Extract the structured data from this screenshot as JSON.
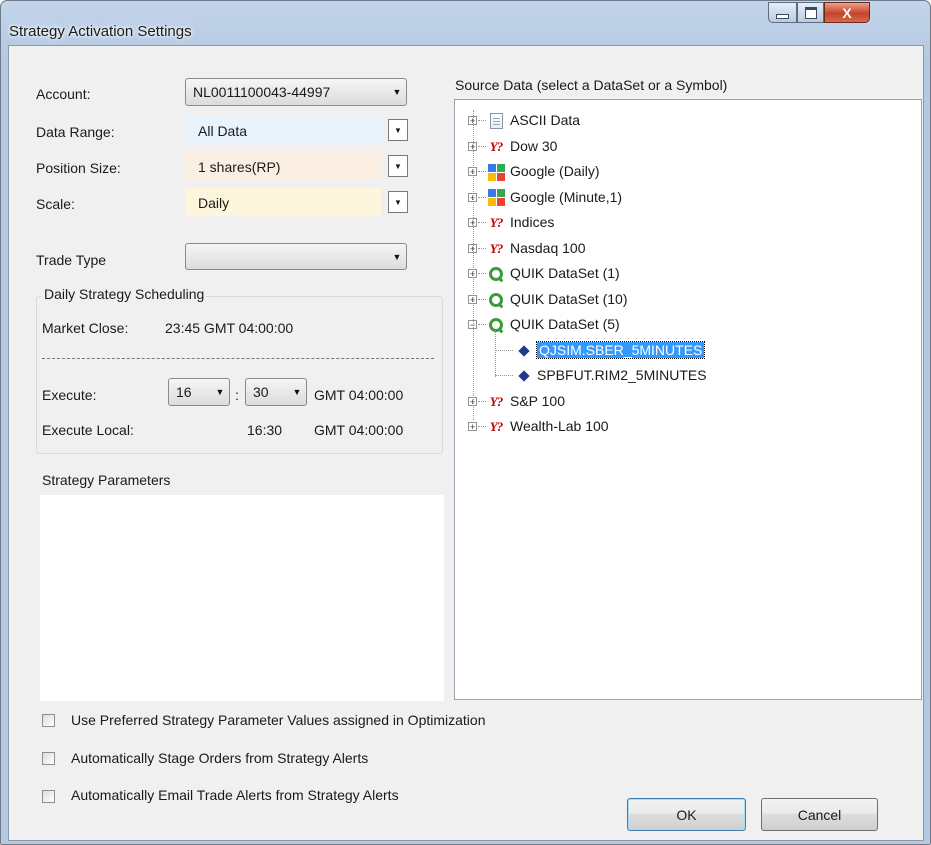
{
  "window": {
    "title": "Strategy Activation Settings",
    "close_glyph": "X"
  },
  "left": {
    "account_label": "Account:",
    "account_value": "NL0011100043-44997",
    "data_range_label": "Data Range:",
    "data_range_value": "All Data",
    "position_size_label": "Position Size:",
    "position_size_value": "1 shares(RP)",
    "scale_label": "Scale:",
    "scale_value": "Daily",
    "trade_type_label": "Trade Type",
    "trade_type_value": "",
    "colors": {
      "data_range_bg": "#e9f3fb",
      "position_size_bg": "#fbeee2",
      "scale_bg": "#fdf5dc"
    }
  },
  "scheduling": {
    "group_label": "Daily Strategy Scheduling",
    "market_close_label": "Market Close:",
    "market_close_value": "23:45 GMT 04:00:00",
    "execute_label": "Execute:",
    "execute_hour": "16",
    "time_separator": ":",
    "execute_minute": "30",
    "execute_tz": "GMT 04:00:00",
    "execute_local_label": "Execute Local:",
    "execute_local_time": "16:30",
    "execute_local_tz": "GMT 04:00:00"
  },
  "parameters": {
    "label": "Strategy Parameters"
  },
  "source": {
    "label": "Source Data (select a DataSet or a Symbol)",
    "items": [
      {
        "label": "ASCII Data",
        "icon": "document-icon",
        "expander": "+"
      },
      {
        "label": "Dow 30",
        "icon": "yahoo-icon",
        "expander": "+"
      },
      {
        "label": "Google (Daily)",
        "icon": "google-icon",
        "expander": "+"
      },
      {
        "label": "Google (Minute,1)",
        "icon": "google-icon",
        "expander": "+"
      },
      {
        "label": "Indices",
        "icon": "yahoo-icon",
        "expander": "+"
      },
      {
        "label": "Nasdaq 100",
        "icon": "yahoo-icon",
        "expander": "+"
      },
      {
        "label": "QUIK DataSet (1)",
        "icon": "quik-icon",
        "expander": "+"
      },
      {
        "label": "QUIK DataSet (10)",
        "icon": "quik-icon",
        "expander": "+"
      },
      {
        "label": "QUIK DataSet (5)",
        "icon": "quik-icon",
        "expander": "-"
      },
      {
        "label": "QJSIM.SBER_5MINUTES",
        "icon": "symbol-icon",
        "selected": true
      },
      {
        "label": "SPBFUT.RIM2_5MINUTES",
        "icon": "symbol-icon"
      },
      {
        "label": "S&P 100",
        "icon": "yahoo-icon",
        "expander": "+"
      },
      {
        "label": "Wealth-Lab 100",
        "icon": "yahoo-icon",
        "expander": "+"
      }
    ],
    "yahoo_glyph": "Y?"
  },
  "options": {
    "preferred_values_label": "Use Preferred Strategy Parameter Values assigned in Optimization",
    "stage_orders_label": "Automatically Stage Orders from Strategy Alerts",
    "email_alerts_label": "Automatically Email Trade Alerts from Strategy Alerts"
  },
  "buttons": {
    "ok": "OK",
    "cancel": "Cancel"
  }
}
